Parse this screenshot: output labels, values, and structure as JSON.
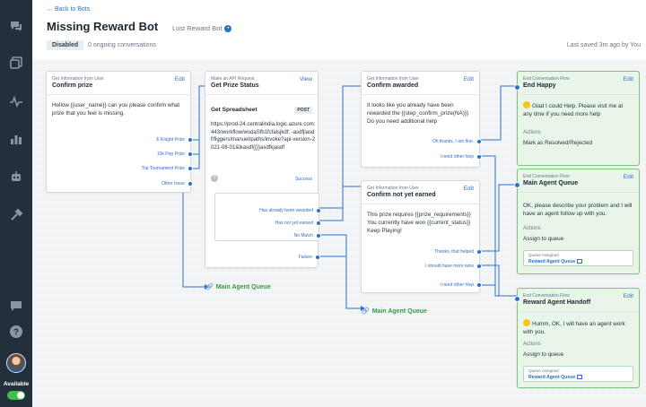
{
  "header": {
    "back_link": "← Back to Bots",
    "title": "Missing Reward Bot",
    "subtitle": "Lost Reward Bot",
    "status": "Disabled",
    "ongoing": "0 ongoing conversations",
    "saved": "Last saved 3m ago by You"
  },
  "sidebar": {
    "icons": [
      "chat-icon",
      "knowledge-icon",
      "activity-icon",
      "reports-icon",
      "bots-icon",
      "tools-icon",
      "message-icon",
      "help-icon"
    ],
    "availability_label": "Available"
  },
  "cards": {
    "confirm_prize": {
      "type": "Get Information from User",
      "title": "Confirm prize",
      "edit": "Edit",
      "body": "Hellow {{user_name}} can you please confirm what prize that you feel is missing.",
      "options": [
        "E Knight Prize",
        "10k Pep Prize",
        "Top Tournament Prize",
        "Other Issue"
      ]
    },
    "prize_status": {
      "type": "Make an API Request",
      "title": "Get Prize Status",
      "view": "View",
      "subheading": "Get Spreadsheet",
      "method": "POST",
      "url": "https://prod-24.centralindia.logic.azure.com:443/workflow/wsdaSfb1fcfalsjkdf; -asdfjlasdf/figgers/manuel/paths/invoke?api-version-2021-08-01&lkasdf{{}}asdfkjasdf",
      "success": "Success",
      "branches": [
        "Has already been awarded",
        "Has not yet earned",
        "No Match"
      ],
      "failure": "Failure"
    },
    "confirm_awarded": {
      "type": "Get Information from User",
      "title": "Confirm awarded",
      "edit": "Edit",
      "body": "It looks like you already have been rewarded the {{step_confirm_prize(NA)}} Do you need additional help",
      "options": [
        "Oh thanks, I am fine.",
        "I need other hlep"
      ]
    },
    "confirm_not_earned": {
      "type": "Get Information from User",
      "title": "Confirm not yet earned",
      "edit": "Edit",
      "body": "This prize requires {{prize_requirements}} You currently have won {{current_status}} Keep Playing!",
      "options": [
        "Thanks, that helped",
        "I should have more wins",
        "I need other hlep"
      ]
    },
    "end_happy": {
      "type": "End Conversation Flow",
      "title": "End Happy",
      "edit": "Edit",
      "body": "Glad I could Help. Please visit me at any time if you need more help",
      "actions_label": "Actions",
      "actions_value": "Mark as Resolved/Rejected"
    },
    "main_agent_queue": {
      "type": "End Conversation Flow",
      "title": "Main Agent Queue",
      "edit": "Edit",
      "body": "OK, please describe your problem and I will have an agent follow up with you.",
      "actions_label": "Actions",
      "actions_value": "Assign to queue",
      "queue_label": "Queue Assigned",
      "queue_value": "Reward Agent Queue"
    },
    "reward_handoff": {
      "type": "End Conversation Flow",
      "title": "Reward Agent Handoff",
      "edit": "Edit",
      "body": "Humm, OK, I will have an agent work with you.",
      "actions_label": "Actions",
      "actions_value": "Assign to queue",
      "queue_label": "Queue Assigned",
      "queue_value": "Reward Agent Queue"
    }
  },
  "floating_labels": {
    "queue_1": "Main Agent Queue",
    "queue_2": "Main Agent Queue"
  },
  "colors": {
    "accent": "#2b6fd1",
    "end_bg": "#e9f5e9",
    "end_border": "#7cc47f",
    "sidebar": "#232f3a",
    "queue_green": "#3a9a3f"
  }
}
